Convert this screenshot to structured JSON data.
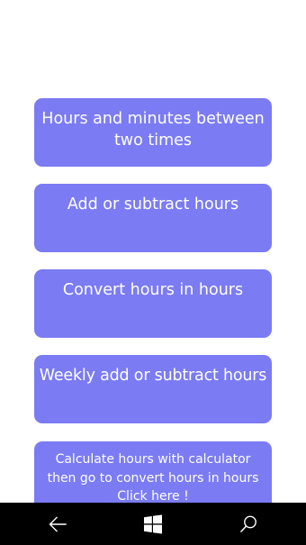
{
  "menu": {
    "buttons": [
      {
        "label": "Hours and minutes between two times"
      },
      {
        "label": "Add or subtract hours"
      },
      {
        "label": "Convert hours in hours"
      },
      {
        "label": "Weekly add or subtract hours"
      },
      {
        "label": "Calculate hours with calculator\nthen go to convert hours in hours\nClick here !"
      }
    ]
  },
  "navbar": {
    "icons": [
      "back-arrow-icon",
      "windows-start-icon",
      "search-icon"
    ]
  },
  "colors": {
    "button_bg": "#7b7bf3",
    "button_text": "#ffffff",
    "navbar_bg": "#000000",
    "navbar_icon": "#ffffff"
  }
}
